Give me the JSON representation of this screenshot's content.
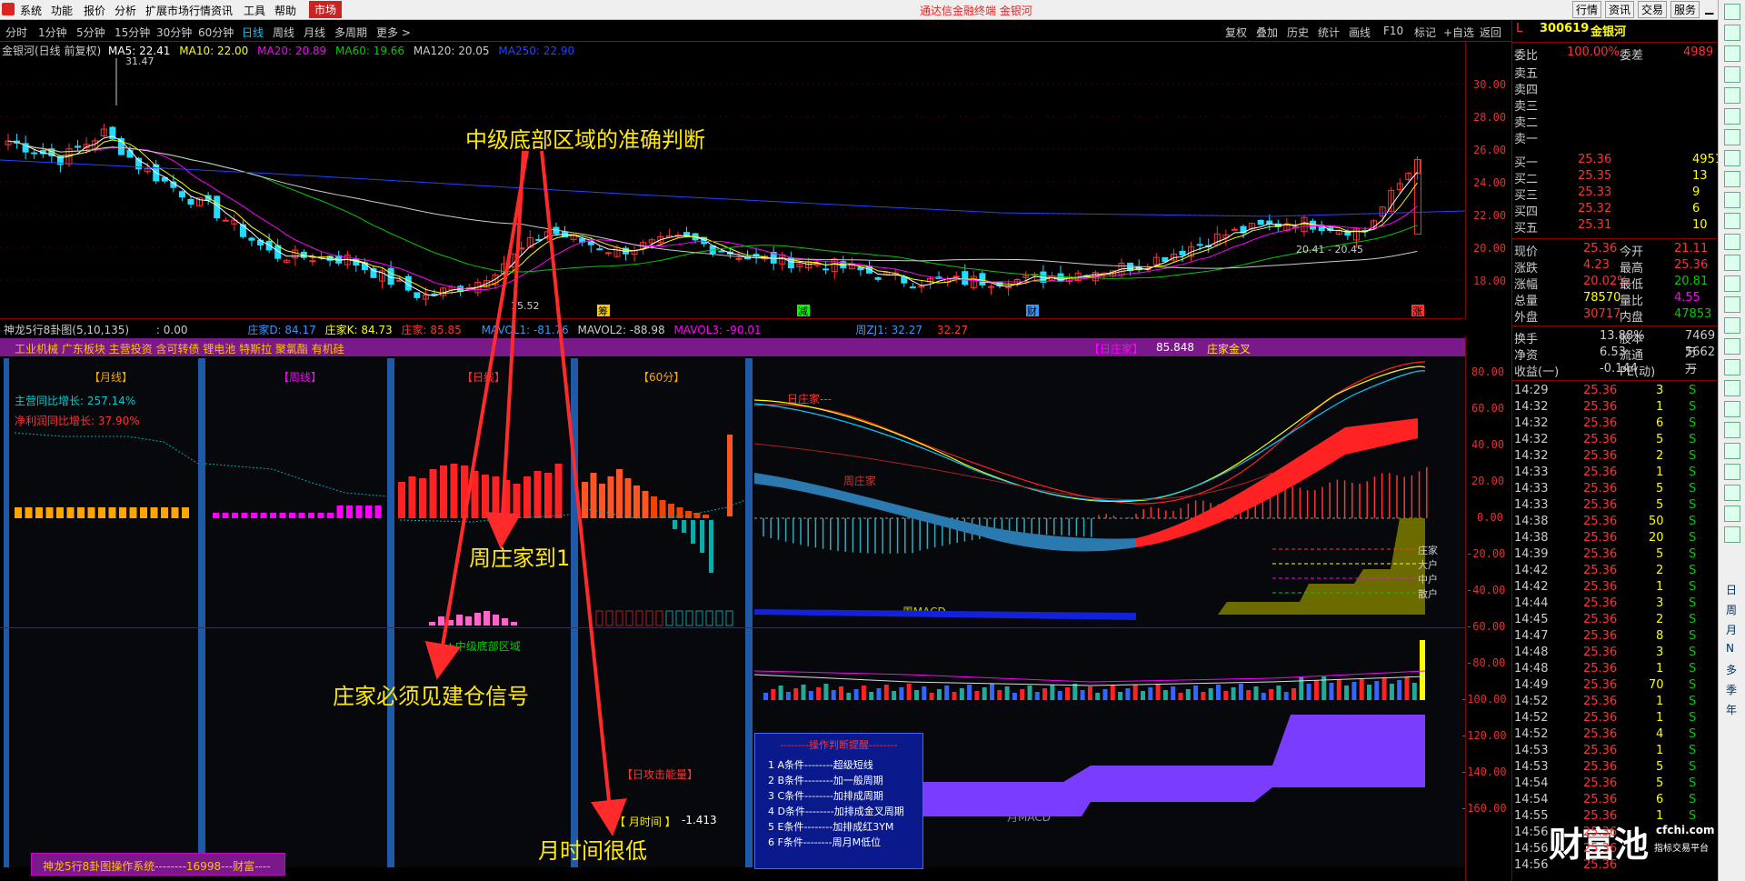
{
  "menu": {
    "items": [
      "系统",
      "功能",
      "报价",
      "分析",
      "扩展市场行情",
      "资讯",
      "工具",
      "帮助"
    ],
    "market": "市场",
    "center": "通达信金融终端  金银河",
    "right": [
      "行情",
      "资讯",
      "交易",
      "服务"
    ]
  },
  "periods": {
    "items": [
      "分时",
      "1分钟",
      "5分钟",
      "15分钟",
      "30分钟",
      "60分钟",
      "日线",
      "周线",
      "月线",
      "多周期",
      "更多 >"
    ],
    "active": "日线",
    "tools": [
      "复权",
      "叠加",
      "历史",
      "统计",
      "画线",
      "F10",
      "标记",
      "+自选",
      "返回"
    ]
  },
  "main": {
    "ma_line": {
      "name": "金银河(日线 前复权)",
      "ma5": "MA5: 22.41",
      "ma10": "MA10: 22.00",
      "ma20": "MA20: 20.89",
      "ma60": "MA60: 19.66",
      "ma120": "MA120: 20.05",
      "ma250": "MA250: 22.90"
    },
    "y_labels": [
      "30.00",
      "28.00",
      "26.00",
      "24.00",
      "22.00",
      "20.00",
      "18.00"
    ],
    "high_label": "31.47",
    "low_label": "15.52",
    "cross_label": "20.41 - 20.45",
    "markers": [
      "筹",
      "减",
      "财",
      "涨"
    ]
  },
  "indicator_bar": {
    "name": "神龙5行8卦图(5,10,135)",
    "value": ": 0.00",
    "d": "庄家D: 84.17",
    "k": "庄家K: 84.73",
    "zj": "庄家: 85.85",
    "mv1": "MAVOL1: -81.76",
    "mv2": "MAVOL2: -88.98",
    "mv3": "MAVOL3: -90.01",
    "zj1": "周ZJ1: 32.27",
    "zj2": "32.27"
  },
  "sub": {
    "sector": "工业机械 广东板块 主营投资 含可转债 锂电池 特斯拉 聚氯酯 有机硅",
    "rzj": "【日庄家】",
    "rzj_val": "85.848",
    "cross": "庄家金叉",
    "p_month": "【月线】",
    "p_week": "【周线】",
    "p_day": "【日线】",
    "p_60": "【60分】",
    "rev_growth": "主营同比增长: 257.14%",
    "profit_growth": "净利润同比增长: 37.90%",
    "mid_bottom": "★中级底部区域",
    "energy": "【日攻击能量】",
    "month_time": "【 月时间 】",
    "month_time_val": "-1.413",
    "rzj_tag": "日庄家---",
    "zhou_zj": "周庄家",
    "zhou_macd": "--- 周MACD ---",
    "yue_macd": "月MACD",
    "y_labels": [
      "80.00",
      "60.00",
      "40.00",
      "20.00",
      "0.00",
      "-20.00",
      "-40.00",
      "-60.00",
      "-80.00",
      "-100.00",
      "-120.00",
      "-140.00",
      "-160.00"
    ],
    "legend": [
      "庄家",
      "大户",
      "中户",
      "散户"
    ],
    "footer": "神龙5行8卦图操作系统--------16998---财富----",
    "guide": {
      "title": "--------操作判断提醒--------",
      "lines": [
        "1  A条件--------超级短线",
        "2  B条件--------加一般周期",
        "3  C条件--------加排成周期",
        "4  D条件--------加排成金叉周期",
        "5  E条件--------加排成红3YM",
        "6  F条件--------周月M低位"
      ]
    }
  },
  "annotations": [
    "中级底部区域的准确判断",
    "周庄家到1",
    "庄家必须见建仓信号",
    "月时间很低"
  ],
  "quote": {
    "code": "300619",
    "name": "金银河",
    "L": "L",
    "webi": "委比",
    "webi_v": "100.00%",
    "weicha": "委差",
    "weicha_v": "4989",
    "sells": [
      "卖五",
      "卖四",
      "卖三",
      "卖二",
      "卖一"
    ],
    "buys": [
      [
        "买一",
        "25.36",
        "4951"
      ],
      [
        "买二",
        "25.35",
        "13"
      ],
      [
        "买三",
        "25.33",
        "9"
      ],
      [
        "买四",
        "25.32",
        "6"
      ],
      [
        "买五",
        "25.31",
        "10"
      ]
    ],
    "stats": [
      [
        "现价",
        "25.36",
        "今开",
        "21.11"
      ],
      [
        "涨跌",
        "4.23",
        "最高",
        "25.36"
      ],
      [
        "涨幅",
        "20.02%",
        "最低",
        "20.81"
      ],
      [
        "总量",
        "78570",
        "量比",
        "4.55"
      ],
      [
        "外盘",
        "30717",
        "内盘",
        "47853"
      ]
    ],
    "stats2": [
      [
        "换手",
        "13.88%",
        "股本",
        "7469万"
      ],
      [
        "净资",
        "6.53",
        "流通",
        "5662万"
      ],
      [
        "收益(一)",
        "-0.144",
        "PE(动)",
        "—"
      ]
    ],
    "ticks": [
      [
        "14:29",
        "25.36",
        "3",
        "S"
      ],
      [
        "14:32",
        "25.36",
        "1",
        "S"
      ],
      [
        "14:32",
        "25.36",
        "6",
        "S"
      ],
      [
        "14:32",
        "25.36",
        "5",
        "S"
      ],
      [
        "14:32",
        "25.36",
        "2",
        "S"
      ],
      [
        "14:33",
        "25.36",
        "1",
        "S"
      ],
      [
        "14:33",
        "25.36",
        "5",
        "S"
      ],
      [
        "14:33",
        "25.36",
        "5",
        "S"
      ],
      [
        "14:38",
        "25.36",
        "50",
        "S"
      ],
      [
        "14:38",
        "25.36",
        "20",
        "S"
      ],
      [
        "14:39",
        "25.36",
        "5",
        "S"
      ],
      [
        "14:42",
        "25.36",
        "2",
        "S"
      ],
      [
        "14:42",
        "25.36",
        "1",
        "S"
      ],
      [
        "14:44",
        "25.36",
        "3",
        "S"
      ],
      [
        "14:45",
        "25.36",
        "2",
        "S"
      ],
      [
        "14:47",
        "25.36",
        "8",
        "S"
      ],
      [
        "14:48",
        "25.36",
        "3",
        "S"
      ],
      [
        "14:48",
        "25.36",
        "1",
        "S"
      ],
      [
        "14:49",
        "25.36",
        "70",
        "S"
      ],
      [
        "14:52",
        "25.36",
        "1",
        "S"
      ],
      [
        "14:52",
        "25.36",
        "1",
        "S"
      ],
      [
        "14:52",
        "25.36",
        "4",
        "S"
      ],
      [
        "14:53",
        "25.36",
        "1",
        "S"
      ],
      [
        "14:53",
        "25.36",
        "5",
        "S"
      ],
      [
        "14:54",
        "25.36",
        "5",
        "S"
      ],
      [
        "14:54",
        "25.36",
        "6",
        "S"
      ],
      [
        "14:55",
        "25.36",
        "1",
        "S"
      ],
      [
        "14:56",
        "25.36",
        "",
        ""
      ],
      [
        "14:56",
        "25.36",
        "",
        ""
      ],
      [
        "14:56",
        "25.36",
        "",
        ""
      ]
    ]
  },
  "sidebar_tabs": [
    "日",
    "周",
    "月",
    "N",
    "多",
    "季",
    "年"
  ],
  "watermark": {
    "brand": "财富池",
    "site": "cfchi.com",
    "slogan": "指标交易平台"
  },
  "colors": {
    "up": "#ff3333",
    "down": "#22ddff",
    "ma5": "#ffffff",
    "ma10": "#ffff00",
    "ma20": "#ff00ff",
    "ma60": "#00cc00",
    "ma120": "#cccccc",
    "ma250": "#2244ff",
    "accent": "#ffea00",
    "sep": "#1e5aa8"
  }
}
